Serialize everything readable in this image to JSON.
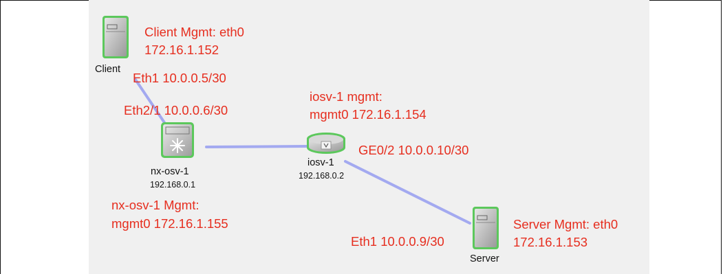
{
  "nodes": {
    "client": {
      "name": "Client",
      "icon": "server-icon"
    },
    "nxosv": {
      "name": "nx-osv-1",
      "ip": "192.168.0.1",
      "icon": "nexus-switch-icon"
    },
    "iosv": {
      "name": "iosv-1",
      "ip": "192.168.0.2",
      "icon": "router-icon"
    },
    "server": {
      "name": "Server",
      "icon": "server-icon"
    }
  },
  "annotations": {
    "client_mgmt_1": "Client Mgmt: eth0",
    "client_mgmt_2": "172.16.1.152",
    "client_eth1": "Eth1 10.0.0.5/30",
    "nx_eth21": "Eth2/1 10.0.0.6/30",
    "iosv_mgmt_1": "iosv-1 mgmt:",
    "iosv_mgmt_2": "mgmt0 172.16.1.154",
    "iosv_ge02": "GE0/2 10.0.0.10/30",
    "nx_mgmt_1": "nx-osv-1 Mgmt:",
    "nx_mgmt_2": "mgmt0 172.16.1.155",
    "server_eth1": "Eth1 10.0.0.9/30",
    "server_mgmt_1": "Server Mgmt: eth0",
    "server_mgmt_2": "172.16.1.153"
  },
  "links": [
    {
      "from": "Client",
      "to": "nx-osv-1"
    },
    {
      "from": "nx-osv-1",
      "to": "iosv-1"
    },
    {
      "from": "iosv-1",
      "to": "Server"
    }
  ],
  "colors": {
    "annotation": "#e62e1f",
    "link": "#a3a9f0",
    "device_green": "#5cc85c",
    "canvas": "#f0f0f0"
  }
}
